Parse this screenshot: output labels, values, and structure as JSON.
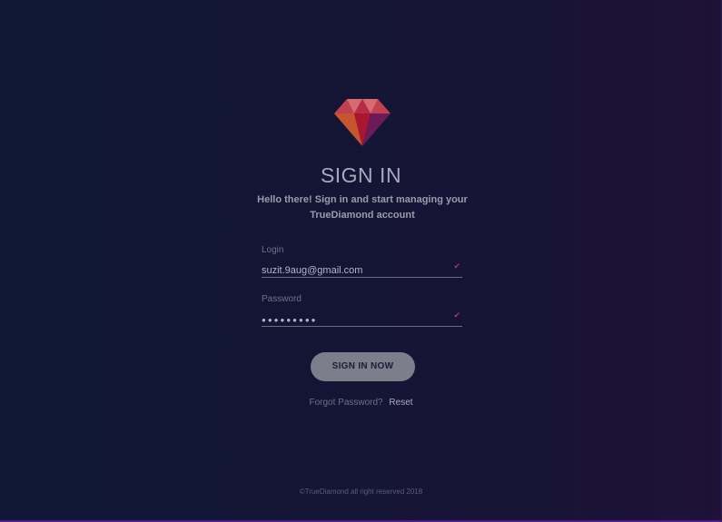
{
  "header": {
    "title": "SIGN IN",
    "subtitle": "Hello there! Sign in and start managing your TrueDiamond account"
  },
  "login": {
    "label": "Login",
    "value": "suzit.9aug@gmail.com",
    "valid": true
  },
  "password": {
    "label": "Password",
    "value": "●●●●●●●●●",
    "valid": true
  },
  "actions": {
    "signin_label": "SIGN IN NOW",
    "forgot_text": "Forgot Password?",
    "reset_label": "Reset"
  },
  "footer": {
    "text": "©TrueDiamond all right reserved 2018"
  },
  "icons": {
    "logo": "diamond-logo-icon",
    "valid_check": "checkmark-icon"
  },
  "colors": {
    "background_left": "#0f1636",
    "background_right": "#1f1138",
    "accent": "#a0376b",
    "button": "#7c7e8c",
    "bottom_border": "#4b1f86"
  }
}
